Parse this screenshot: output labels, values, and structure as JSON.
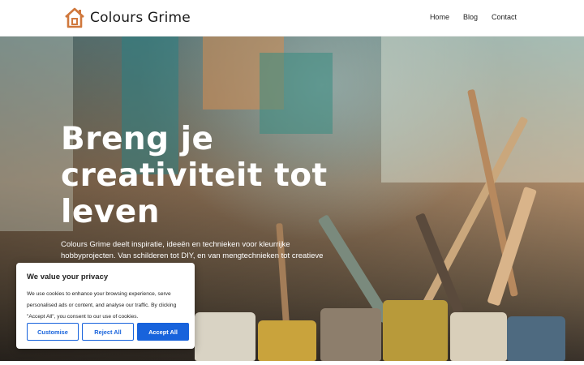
{
  "site": {
    "name": "Colours Grime"
  },
  "nav": {
    "items": [
      "Home",
      "Blog",
      "Contact"
    ]
  },
  "hero": {
    "title": "Breng je creativiteit tot leven",
    "intro": "Colours Grime deelt inspiratie, ideeën en technieken voor kleurrijke hobbyprojecten. Van schilderen tot DIY, en van mengtechnieken tot creatieve tools — alles om jouw"
  },
  "cookie": {
    "title": "We value your privacy",
    "text": "We use cookies to enhance your browsing experience, serve personalised ads or content, and analyse our traffic. By clicking \"Accept All\", you consent to our use of cookies.",
    "customise": "Customise",
    "reject": "Reject All",
    "accept": "Accept All"
  },
  "colors": {
    "primary_button": "#1863dc",
    "logo_accent": "#d0783c"
  },
  "icons": {
    "logo": "house-icon"
  }
}
